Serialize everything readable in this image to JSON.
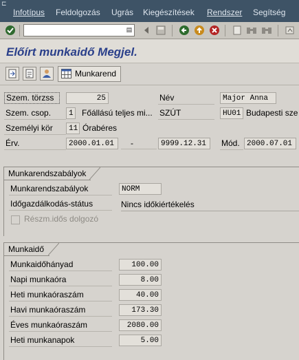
{
  "menubar": {
    "items": [
      "Infotípus",
      "Feldolgozás",
      "Ugrás",
      "Kiegészítések",
      "Rendszer",
      "Segítség"
    ]
  },
  "toolbar": {
    "command_value": ""
  },
  "title": "Előírt munkaidő Megjel.",
  "app_toolbar": {
    "munkarend_label": "Munkarend"
  },
  "header": {
    "szem_torzss_label": "Szem. törzss",
    "szem_torzss_value": "25",
    "nev_label": "Név",
    "nev_value": "Major Anna",
    "szem_csop_label": "Szem. csop.",
    "szem_csop_code": "1",
    "szem_csop_text": "Főállású teljes mi...",
    "szut_label": "SZÚT",
    "szut_code": "HU01",
    "szut_text": "Budapesti sze",
    "szem_kor_label": "Személyi kör",
    "szem_kor_code": "11",
    "szem_kor_text": "Órabéres",
    "erv_label": "Érv.",
    "erv_from": "2000.01.01",
    "erv_dash": "-",
    "erv_to": "9999.12.31",
    "mod_label": "Mód.",
    "mod_value": "2000.07.01"
  },
  "munkarend_group": {
    "title": "Munkarendszabályok",
    "rule_label": "Munkarendszabályok",
    "rule_value": "NORM",
    "status_label": "Időgazdálkodás-státus",
    "status_value": "Nincs időkiértékelés",
    "part_time_label": "Részm.idős dolgozó",
    "part_time_checked": false
  },
  "munkaido_group": {
    "title": "Munkaidő",
    "rows": [
      {
        "label": "Munkaidőhányad",
        "value": "100.00"
      },
      {
        "label": "Napi munkaóra",
        "value": "8.00"
      },
      {
        "label": "Heti munkaóraszám",
        "value": "40.00"
      },
      {
        "label": "Havi munkaóraszám",
        "value": "173.30"
      },
      {
        "label": "Éves munkaóraszám",
        "value": "2080.00"
      },
      {
        "label": "Heti munkanapok",
        "value": "5.00"
      }
    ]
  },
  "colors": {
    "menubar_bg": "#3e5366",
    "title_color": "#2a3f8a",
    "window_bg": "#d6d3ce"
  }
}
